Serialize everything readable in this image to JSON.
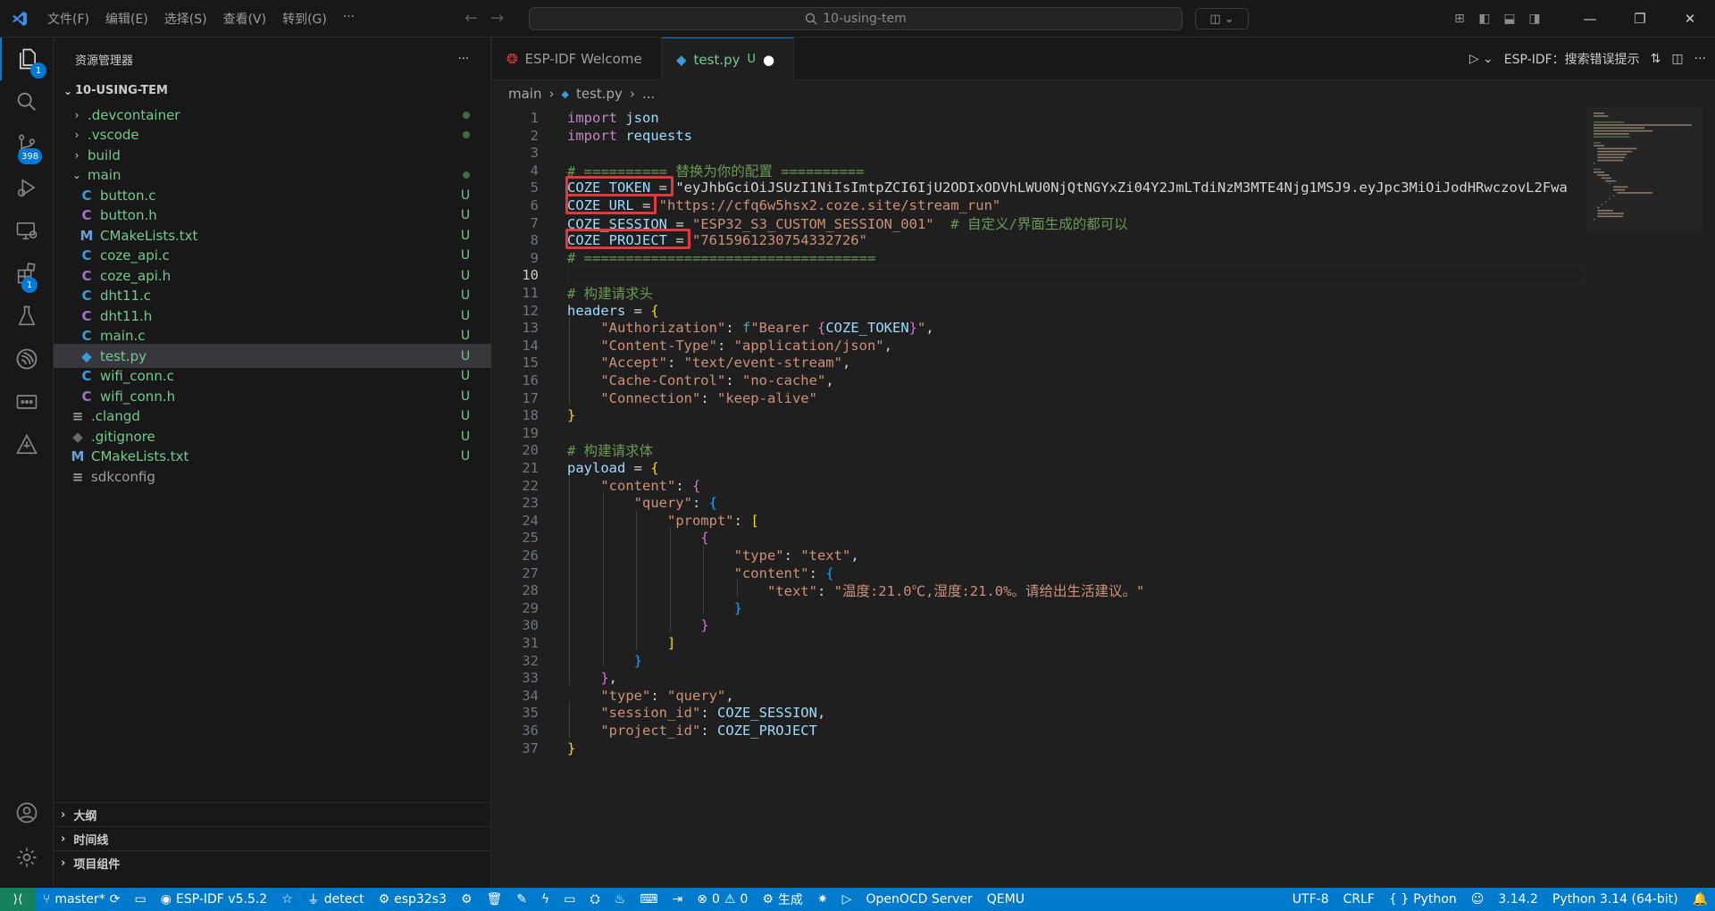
{
  "titlebar": {
    "menu": [
      "文件(F)",
      "编辑(E)",
      "选择(S)",
      "查看(V)",
      "转到(G)",
      "···"
    ],
    "search": "10-using-tem"
  },
  "activity": {
    "explorer_badge": "1",
    "scm_badge": "398",
    "extensions_badge": "1"
  },
  "sidebar": {
    "title": "资源管理器",
    "more": "···",
    "project": "10-USING-TEM",
    "items": [
      {
        "label": ".devcontainer",
        "kind": "folder",
        "status": "dot"
      },
      {
        "label": ".vscode",
        "kind": "folder",
        "status": "dot"
      },
      {
        "label": "build",
        "kind": "folder",
        "status": ""
      },
      {
        "label": "main",
        "kind": "folder-open",
        "status": "dot"
      },
      {
        "label": "button.c",
        "kind": "c",
        "status": "U"
      },
      {
        "label": "button.h",
        "kind": "h",
        "status": "U"
      },
      {
        "label": "CMakeLists.txt",
        "kind": "cmake",
        "status": "U"
      },
      {
        "label": "coze_api.c",
        "kind": "c",
        "status": "U"
      },
      {
        "label": "coze_api.h",
        "kind": "h",
        "status": "U"
      },
      {
        "label": "dht11.c",
        "kind": "c",
        "status": "U"
      },
      {
        "label": "dht11.h",
        "kind": "h",
        "status": "U"
      },
      {
        "label": "main.c",
        "kind": "c",
        "status": "U"
      },
      {
        "label": "test.py",
        "kind": "py",
        "status": "U"
      },
      {
        "label": "wifi_conn.c",
        "kind": "c",
        "status": "U"
      },
      {
        "label": "wifi_conn.h",
        "kind": "h",
        "status": "U"
      },
      {
        "label": ".clangd",
        "kind": "file",
        "status": "U"
      },
      {
        "label": ".gitignore",
        "kind": "git",
        "status": "U"
      },
      {
        "label": "CMakeLists.txt",
        "kind": "cmake",
        "status": "U"
      },
      {
        "label": "sdkconfig",
        "kind": "file",
        "status": ""
      }
    ],
    "sections": [
      "大纲",
      "时间线",
      "项目组件"
    ]
  },
  "tabs": [
    {
      "label": "ESP-IDF Welcome",
      "active": false
    },
    {
      "label": "test.py",
      "status": "U",
      "active": true
    }
  ],
  "tab_actions": {
    "esp": "ESP-IDF：搜索错误提示"
  },
  "breadcrumb": [
    "main",
    "test.py",
    "..."
  ],
  "code_lines": [
    "import json",
    "import requests",
    "",
    "# ========== 替换为你的配置 ==========",
    "COZE_TOKEN = \"eyJhbGciOiJSUzI1NiIsImtpZCI6IjU2ODIxODVhLWU0NjQtNGYxZi04Y2JmLTdiNzM3MTE4Njg1MSJ9.eyJpc3MiOiJodHRwczovL2Fwa",
    "COZE_URL = \"https://cfq6w5hsx2.coze.site/stream_run\"",
    "COZE_SESSION = \"ESP32_S3_CUSTOM_SESSION_001\"  # 自定义/界面生成的都可以",
    "COZE_PROJECT = \"7615961230754332726\"",
    "# ===================================",
    "",
    "# 构建请求头",
    "headers = {",
    "    \"Authorization\": f\"Bearer {COZE_TOKEN}\",",
    "    \"Content-Type\": \"application/json\",",
    "    \"Accept\": \"text/event-stream\",",
    "    \"Cache-Control\": \"no-cache\",",
    "    \"Connection\": \"keep-alive\"",
    "}",
    "",
    "# 构建请求体",
    "payload = {",
    "    \"content\": {",
    "        \"query\": {",
    "            \"prompt\": [",
    "                {",
    "                    \"type\": \"text\",",
    "                    \"content\": {",
    "                        \"text\": \"温度:21.0℃,湿度:21.0%。请给出生活建议。\"",
    "                    }",
    "                }",
    "            ]",
    "        }",
    "    },",
    "    \"type\": \"query\",",
    "    \"session_id\": COZE_SESSION,",
    "    \"project_id\": COZE_PROJECT",
    "}"
  ],
  "status": {
    "branch": "master*",
    "idf": "ESP-IDF v5.5.2",
    "detect": "detect",
    "target": "esp32s3",
    "errors": "0",
    "warnings": "0",
    "build": "生成",
    "openocd": "OpenOCD Server",
    "qemu": "QEMU",
    "encoding": "UTF-8",
    "eol": "CRLF",
    "lang": "Python",
    "pyver": "3.14.2",
    "interp": "Python 3.14 (64-bit)"
  }
}
